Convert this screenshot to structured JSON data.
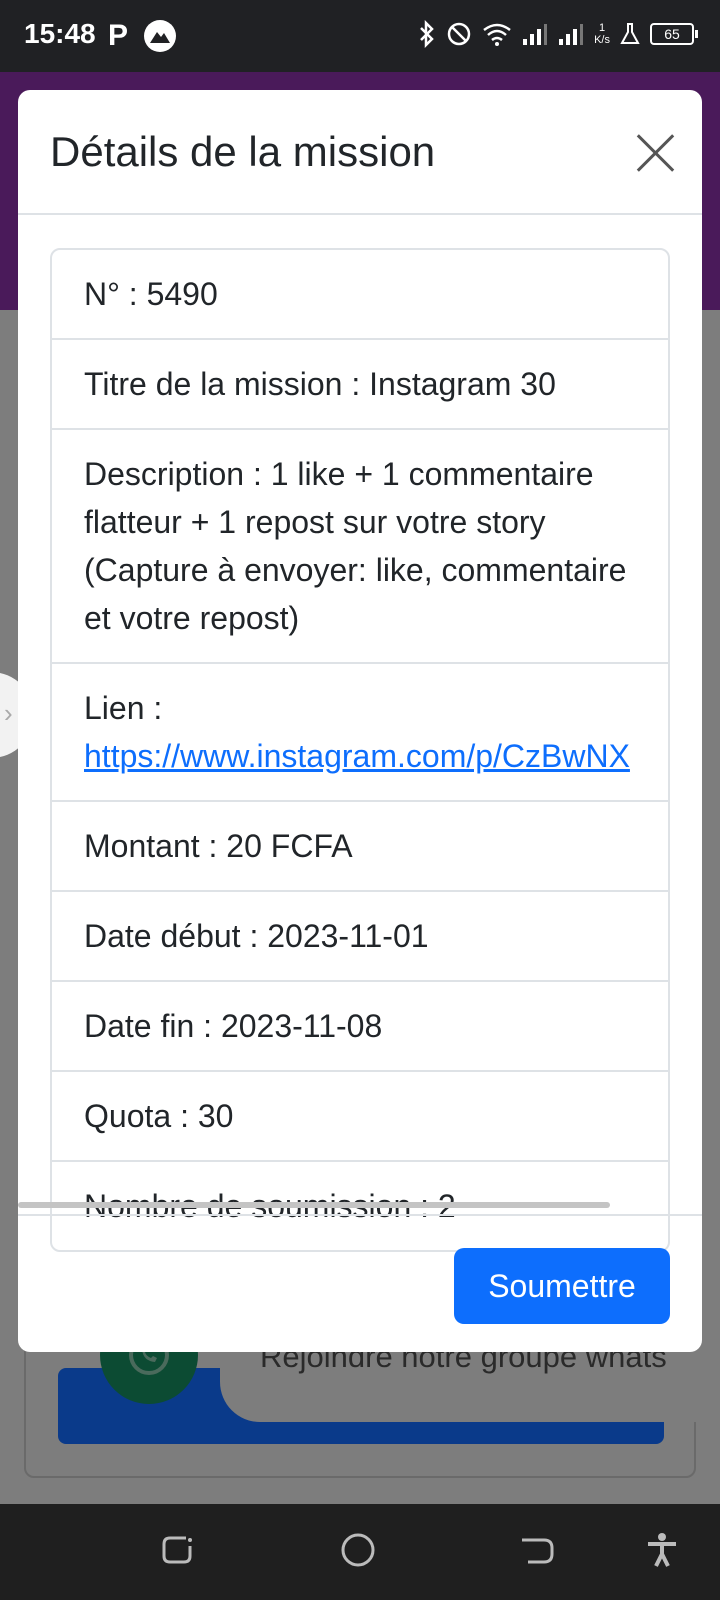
{
  "status_bar": {
    "time": "15:48",
    "net_speed_value": "1",
    "net_speed_unit": "K/s",
    "battery": "65"
  },
  "modal": {
    "title": "Détails de la mission",
    "items": [
      {
        "label": "N°",
        "value": "5490"
      },
      {
        "label": "Titre de la mission",
        "value": "Instagram 30"
      },
      {
        "label": "Description",
        "value": "1 like + 1 commentaire flatteur + 1 repost sur votre story (Capture à envoyer: like, commentaire et votre repost)"
      },
      {
        "label": "Lien",
        "value": "https://www.instagram.com/p/CzBwNX"
      },
      {
        "label": "Montant",
        "value": "20 FCFA"
      },
      {
        "label": "Date début",
        "value": "2023-11-01"
      },
      {
        "label": "Date fin",
        "value": "2023-11-08"
      },
      {
        "label": "Quota",
        "value": "30"
      },
      {
        "label": "Nombre de soumission",
        "value": "2"
      }
    ],
    "submit_label": "Soumettre"
  },
  "background": {
    "group_text": "Rejoindre notre groupe whats"
  },
  "colors": {
    "primary": "#0d6efd",
    "header_purple": "#4a1a5a"
  },
  "icons": {
    "close": "close-icon",
    "whatsapp": "whatsapp-icon",
    "bluetooth": "bluetooth-icon",
    "wifi": "wifi-icon",
    "battery": "battery-icon"
  }
}
